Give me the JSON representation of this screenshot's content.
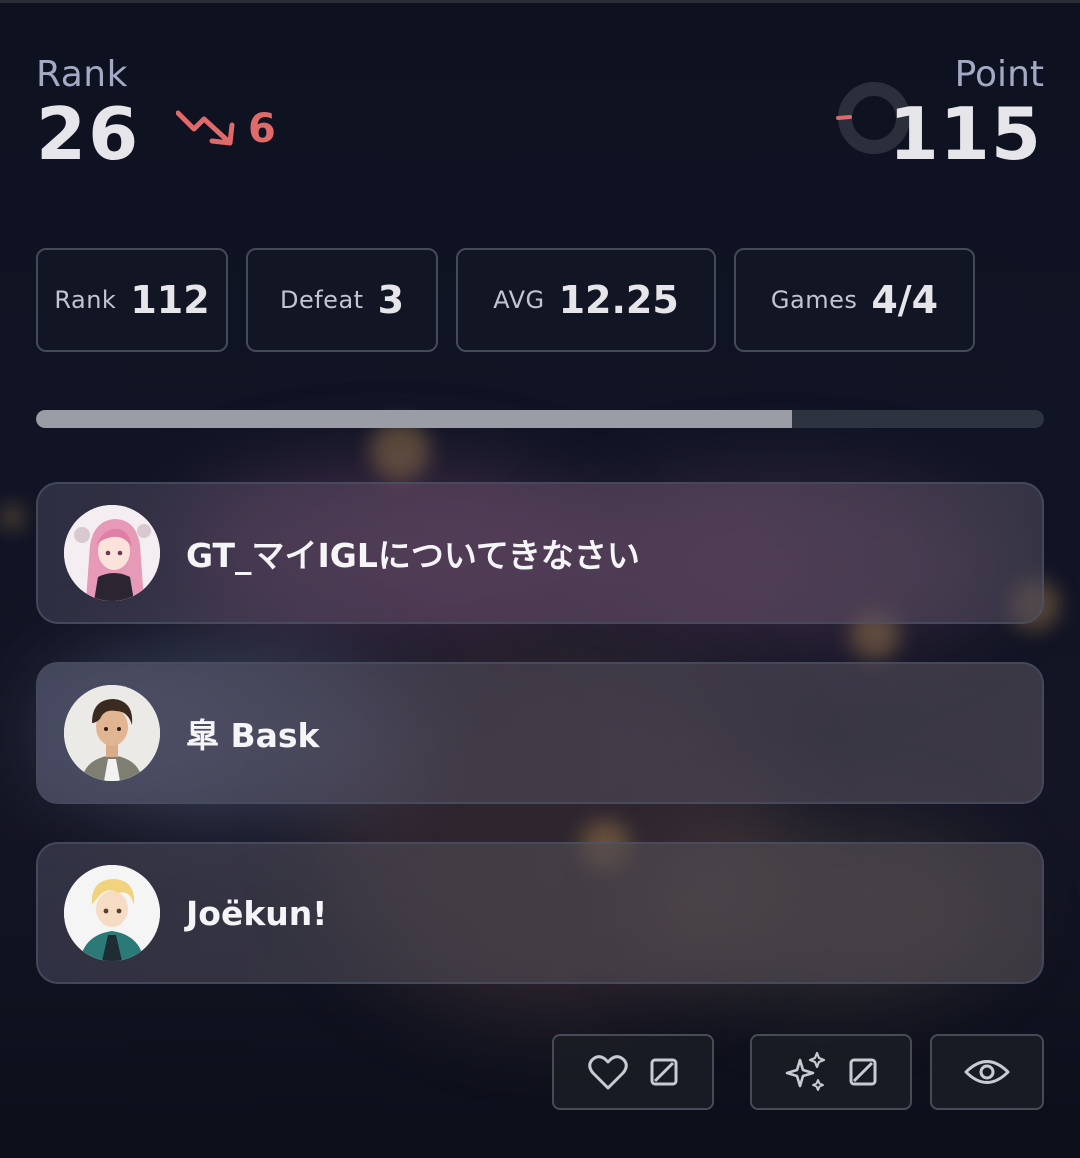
{
  "header": {
    "rank_label": "Rank",
    "rank_value": "26",
    "rank_change": "6",
    "rank_change_direction": "down",
    "point_label": "Point",
    "point_value": "115",
    "point_ring_progress": 0.02
  },
  "stats": [
    {
      "label": "Rank",
      "value": "112"
    },
    {
      "label": "Defeat",
      "value": "3"
    },
    {
      "label": "AVG",
      "value": "12.25"
    },
    {
      "label": "Games",
      "value": "4/4"
    }
  ],
  "progress": {
    "fraction": 0.75
  },
  "players": [
    {
      "name": "GT_マイIGLについてきなさい",
      "avatar": "pink-hair-anime-avatar"
    },
    {
      "name": "皐 Bask",
      "avatar": "dark-hair-man-avatar"
    },
    {
      "name": "Joëkun!",
      "avatar": "blonde-boy-avatar"
    }
  ],
  "actions": [
    {
      "icons": [
        "heart-icon",
        "square-slash-icon"
      ]
    },
    {
      "icons": [
        "sparkles-icon",
        "square-slash-icon"
      ]
    },
    {
      "icons": [
        "eye-icon"
      ]
    }
  ],
  "colors": {
    "background": "#0c101d",
    "accent_down": "#e06a6a",
    "chip_border": "#454a57",
    "progress_fill": "#9a9ca6",
    "progress_track": "#2e3340"
  }
}
